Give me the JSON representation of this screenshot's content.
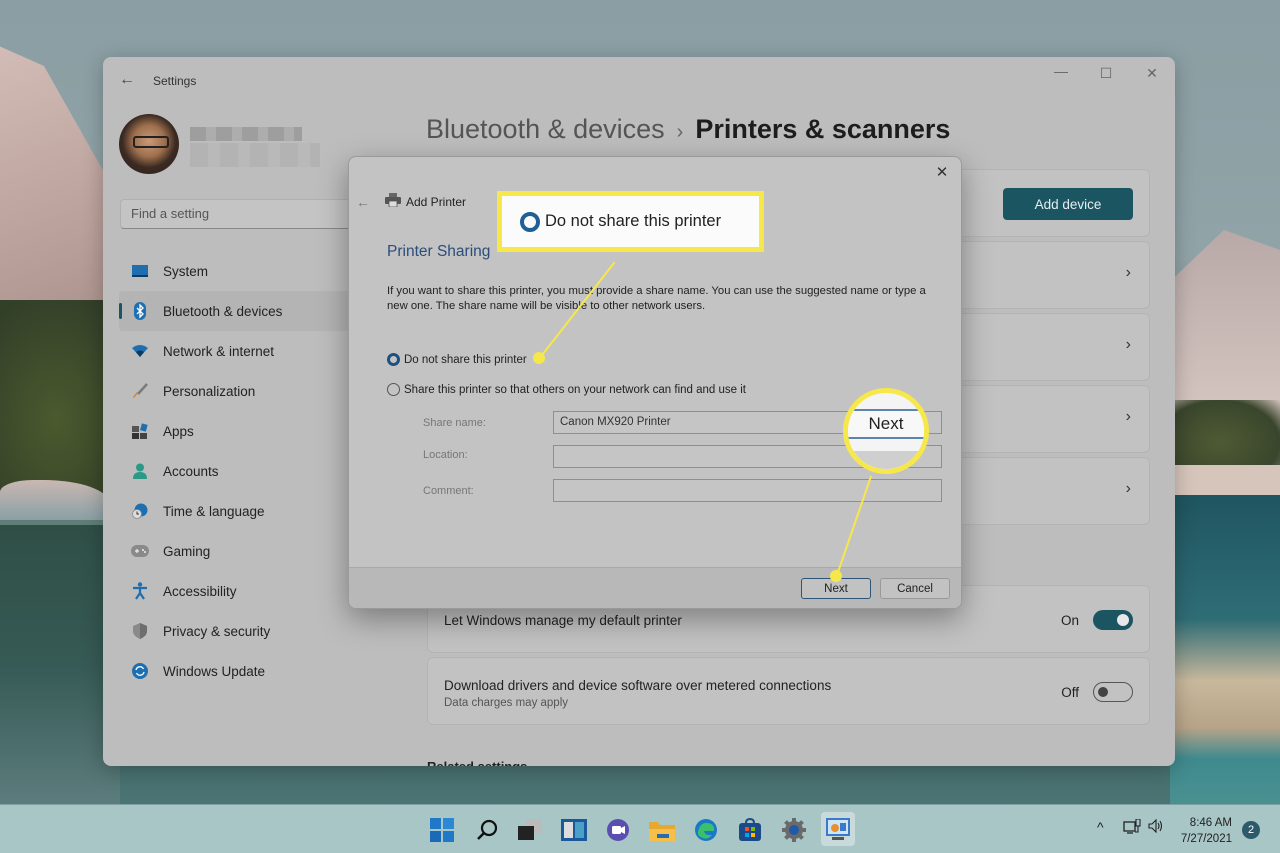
{
  "window": {
    "title": "Settings",
    "back_icon": "←",
    "controls": {
      "minimize": "—",
      "maximize": "☐",
      "close": "✕"
    }
  },
  "search": {
    "placeholder": "Find a setting"
  },
  "sidebar": {
    "items": [
      {
        "label": "System",
        "icon": "system-icon",
        "active": false
      },
      {
        "label": "Bluetooth & devices",
        "icon": "bluetooth-icon",
        "active": true
      },
      {
        "label": "Network & internet",
        "icon": "wifi-icon",
        "active": false
      },
      {
        "label": "Personalization",
        "icon": "brush-icon",
        "active": false
      },
      {
        "label": "Apps",
        "icon": "apps-icon",
        "active": false
      },
      {
        "label": "Accounts",
        "icon": "person-icon",
        "active": false
      },
      {
        "label": "Time & language",
        "icon": "clock-globe-icon",
        "active": false
      },
      {
        "label": "Gaming",
        "icon": "gamepad-icon",
        "active": false
      },
      {
        "label": "Accessibility",
        "icon": "accessibility-icon",
        "active": false
      },
      {
        "label": "Privacy & security",
        "icon": "shield-icon",
        "active": false
      },
      {
        "label": "Windows Update",
        "icon": "update-icon",
        "active": false
      }
    ]
  },
  "breadcrumb": {
    "parent": "Bluetooth & devices",
    "separator": "›",
    "current": "Printers & scanners"
  },
  "main": {
    "add_device_label": "Add device",
    "chevron": "›",
    "settings": [
      {
        "title": "Let Windows manage my default printer",
        "subtitle": "",
        "state": "On",
        "enabled": true
      },
      {
        "title": "Download drivers and device software over metered connections",
        "subtitle": "Data charges may apply",
        "state": "Off",
        "enabled": false
      }
    ],
    "related_heading": "Related settings"
  },
  "dialog": {
    "close": "✕",
    "back": "←",
    "title": "Add Printer",
    "heading": "Printer Sharing",
    "description": "If you want to share this printer, you must provide a share name. You can use the suggested name or type a new one. The share name will be visible to other network users.",
    "options": [
      {
        "label": "Do not share this printer",
        "checked": true
      },
      {
        "label": "Share this printer so that others on your network can find and use it",
        "checked": false
      }
    ],
    "fields": [
      {
        "label": "Share name:",
        "value": "Canon MX920 Printer"
      },
      {
        "label": "Location:",
        "value": ""
      },
      {
        "label": "Comment:",
        "value": ""
      }
    ],
    "buttons": {
      "next": "Next",
      "cancel": "Cancel"
    }
  },
  "callouts": {
    "option_zoom_label": "Do not share this printer",
    "button_zoom_label": "Next",
    "color": "#f6e84a"
  },
  "taskbar": {
    "apps": [
      {
        "name": "start-icon"
      },
      {
        "name": "search-icon"
      },
      {
        "name": "task-view-icon"
      },
      {
        "name": "widgets-icon"
      },
      {
        "name": "teams-chat-icon"
      },
      {
        "name": "file-explorer-icon"
      },
      {
        "name": "edge-icon"
      },
      {
        "name": "store-icon"
      },
      {
        "name": "settings-icon"
      },
      {
        "name": "control-panel-icon"
      }
    ],
    "tray": {
      "chevron": "^",
      "network": "🖧",
      "volume": "🔈"
    },
    "time": "8:46 AM",
    "date": "7/27/2021",
    "notifications": "2"
  },
  "colors": {
    "accent": "#1b5561",
    "dialog_heading": "#2b4d7a",
    "radio_selected": "#1e4f7e",
    "callout": "#f6e84a"
  }
}
